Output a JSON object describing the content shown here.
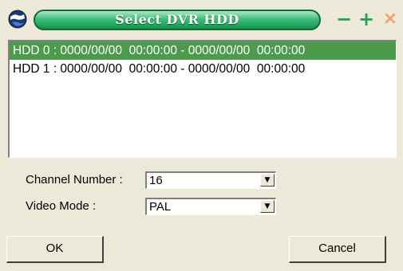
{
  "window": {
    "title": "Select DVR HDD",
    "title_color": "#1f9a55",
    "buttons": {
      "minimize": "−",
      "maximize": "+",
      "close": "×"
    },
    "icon": "globe-app-icon"
  },
  "hdd_list": {
    "items": [
      {
        "label": "HDD 0 : 0000/00/00  00:00:00 - 0000/00/00  00:00:00",
        "selected": true
      },
      {
        "label": "HDD 1 : 0000/00/00  00:00:00 - 0000/00/00  00:00:00",
        "selected": false
      }
    ],
    "selection_color": "#4c9a4c"
  },
  "form": {
    "channel_number": {
      "label": "Channel Number :",
      "value": "16"
    },
    "video_mode": {
      "label": "Video Mode :",
      "value": "PAL"
    }
  },
  "actions": {
    "ok_label": "OK",
    "cancel_label": "Cancel"
  }
}
